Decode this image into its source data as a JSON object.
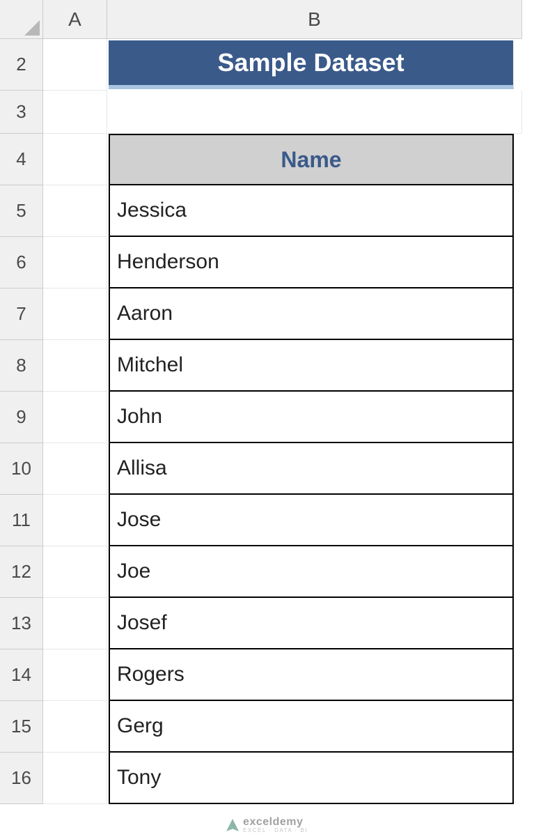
{
  "columns": [
    "A",
    "B"
  ],
  "rows": [
    "2",
    "3",
    "4",
    "5",
    "6",
    "7",
    "8",
    "9",
    "10",
    "11",
    "12",
    "13",
    "14",
    "15",
    "16"
  ],
  "title": "Sample Dataset",
  "table_header": "Name",
  "names": [
    "Jessica",
    "Henderson",
    "Aaron",
    "Mitchel",
    "John",
    "Allisa",
    "Jose",
    "Joe",
    "Josef",
    "Rogers",
    "Gerg",
    "Tony"
  ],
  "watermark": {
    "main": "exceldemy",
    "sub": "EXCEL · DATA · BI"
  },
  "style": {
    "title_bg": "#3a5a8a",
    "title_underline": "#a8c4e0",
    "header_bg": "#d0d0d0",
    "header_fg": "#3a5a8a"
  }
}
